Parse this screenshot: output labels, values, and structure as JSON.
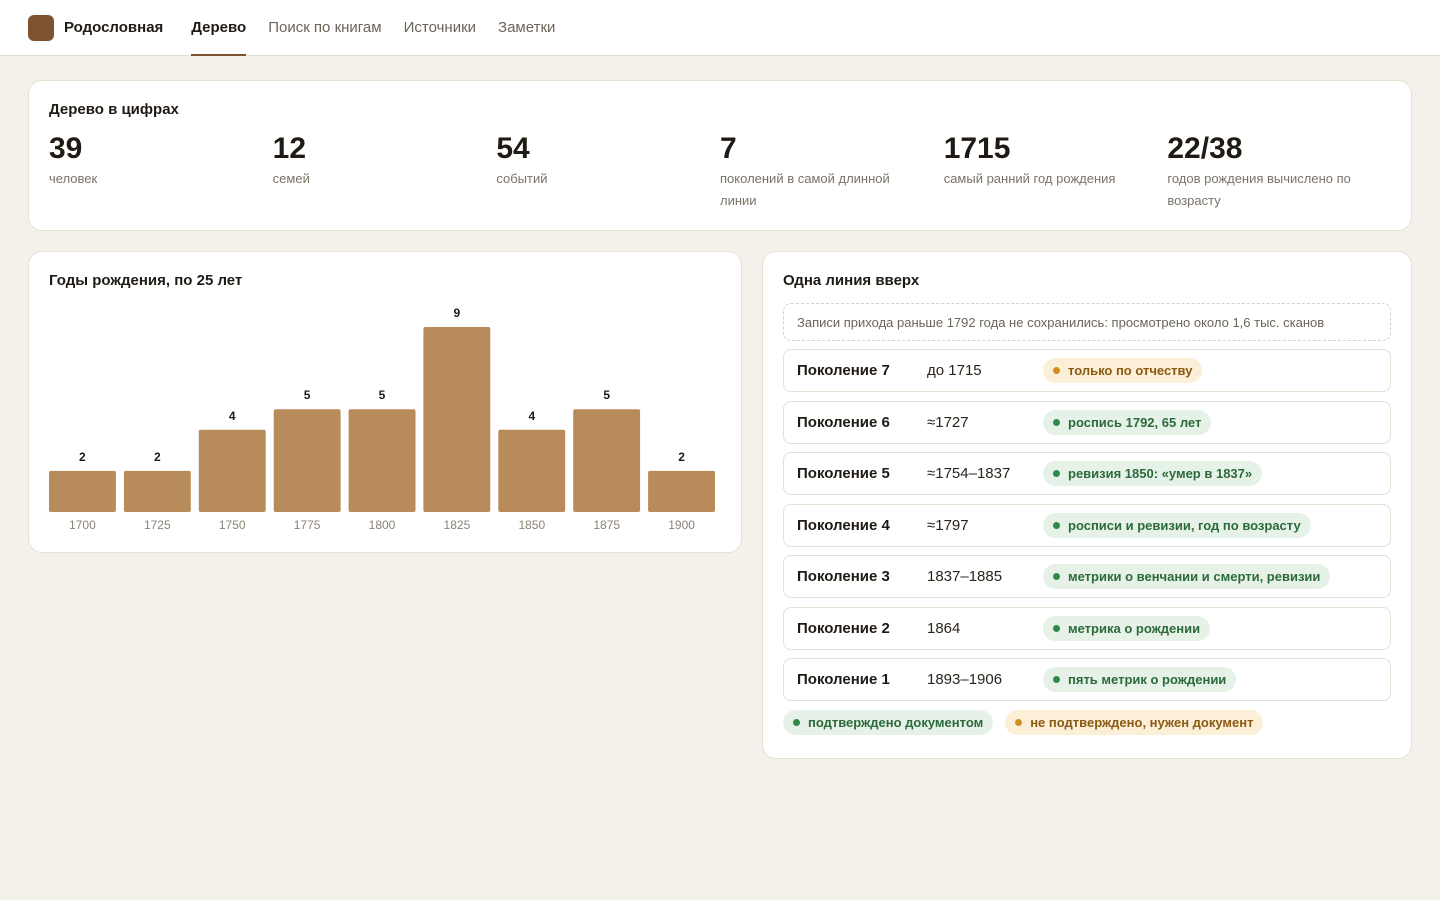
{
  "header": {
    "brand": "Родословная",
    "nav": [
      {
        "label": "Дерево",
        "active": true
      },
      {
        "label": "Поиск по книгам",
        "active": false
      },
      {
        "label": "Источники",
        "active": false
      },
      {
        "label": "Заметки",
        "active": false
      }
    ]
  },
  "stats": {
    "title": "Дерево в цифрах",
    "items": [
      {
        "value": "39",
        "label": "человек"
      },
      {
        "value": "12",
        "label": "семей"
      },
      {
        "value": "54",
        "label": "событий"
      },
      {
        "value": "7",
        "label": "поколений в самой длинной линии"
      },
      {
        "value": "1715",
        "label": "самый ранний год рождения"
      },
      {
        "value": "22/38",
        "label": "годов рождения вычислено по возрасту"
      }
    ]
  },
  "chart": {
    "title": "Годы рождения, по 25 лет"
  },
  "chart_data": {
    "type": "bar",
    "title": "Годы рождения, по 25 лет",
    "categories": [
      "1700",
      "1725",
      "1750",
      "1775",
      "1800",
      "1825",
      "1850",
      "1875",
      "1900"
    ],
    "values": [
      2,
      2,
      4,
      5,
      5,
      9,
      4,
      5,
      2
    ],
    "ylim": [
      0,
      9
    ],
    "color": "#b88b5a",
    "grid": false,
    "legend": "none"
  },
  "lineage": {
    "title": "Одна линия вверх",
    "note": "Записи прихода раньше 1792 года не сохранились: просмотрено около 1,6 тыс. сканов",
    "generations": [
      {
        "name": "Поколение 7",
        "years": "до 1715",
        "status": "warn",
        "source": "только по отчеству"
      },
      {
        "name": "Поколение 6",
        "years": "≈1727",
        "status": "ok",
        "source": "роспись 1792, 65 лет"
      },
      {
        "name": "Поколение 5",
        "years": "≈1754–1837",
        "status": "ok",
        "source": "ревизия 1850: «умер в 1837»"
      },
      {
        "name": "Поколение 4",
        "years": "≈1797",
        "status": "ok",
        "source": "росписи и ревизии, год по возрасту"
      },
      {
        "name": "Поколение 3",
        "years": "1837–1885",
        "status": "ok",
        "source": "метрики о венчании и смерти, ревизии"
      },
      {
        "name": "Поколение 2",
        "years": "1864",
        "status": "ok",
        "source": "метрика о рождении"
      },
      {
        "name": "Поколение 1",
        "years": "1893–1906",
        "status": "ok",
        "source": "пять метрик о рождении"
      }
    ],
    "legend": {
      "ok": "подтверждено документом",
      "warn": "не подтверждено, нужен документ"
    }
  },
  "colors": {
    "accent": "#7e5230",
    "bar": "#b88b5a",
    "ok": "#2f8a4a",
    "warn": "#d1901f"
  }
}
